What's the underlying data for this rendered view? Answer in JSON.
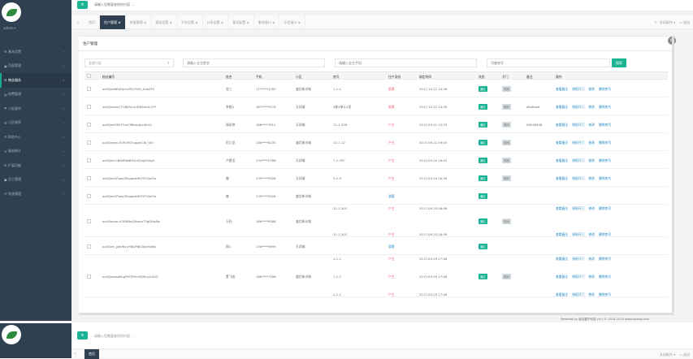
{
  "app": {
    "user": "admin+"
  },
  "topbar": {
    "search_placeholder": "请输入您需要查找的内容 ..."
  },
  "sidebar": {
    "items": [
      {
        "label": "基本设置",
        "active": false
      },
      {
        "label": "页面管理",
        "active": false
      },
      {
        "label": "物业服务",
        "active": true
      },
      {
        "label": "收费管理",
        "active": false
      },
      {
        "label": "小区超市",
        "active": false
      },
      {
        "label": "小区商家",
        "active": false
      },
      {
        "label": "财务中心",
        "active": false
      },
      {
        "label": "服务统计",
        "active": false
      },
      {
        "label": "扩展功能",
        "active": false
      },
      {
        "label": "员工管理",
        "active": false
      },
      {
        "label": "系统管理",
        "active": false
      }
    ]
  },
  "tabs": {
    "items": [
      "首页",
      "住户管理 ⊗",
      "房屋管理 ⊗",
      "基础设置 ⊗",
      "平台设置 ⊗",
      "分享设置 ⊗",
      "基本配置 ⊗",
      "聚合接口 ⊗",
      "乐信接口 ⊗"
    ],
    "close_ops": "关闭操作 ▾",
    "logout": "⇨ 退出"
  },
  "panel": {
    "title": "住户管理",
    "filters": {
      "community": "全部小区",
      "name_placeholder": "请输入业主姓名",
      "phone_placeholder": "请输入业主手机",
      "room_placeholder": "可查房号",
      "search_btn": "搜索"
    },
    "columns": [
      "粉丝编号",
      "姓名",
      "手机",
      "小区",
      "房号",
      "住户身份",
      "绑定时间",
      "状态",
      "开门",
      "备注",
      "操作"
    ],
    "rows": [
      {
        "id": "oo4Qee8RdGJmuRTLPhlH_XobZFll",
        "name": "张三",
        "phone": "177****4762",
        "community": "盛芯新水城",
        "rooms": [
          "1-1-1"
        ],
        "roles": [
          "家属"
        ],
        "times": [
          "2017-10-12 14:36"
        ],
        "status": "通过",
        "door": "关闭",
        "note": "",
        "ops": [
          "查看备注",
          "授权开门",
          "修改",
          "删除房号"
        ]
      },
      {
        "id": "oo4QeexloT7U8DVynUZN6vt0LOYY",
        "name": "李晓Ji",
        "phone": "187****3576",
        "community": "天润城",
        "rooms": [
          "4栋4单元4室"
        ],
        "roles": [
          "家属"
        ],
        "times": [
          "2017-10-12 14:35"
        ],
        "status": "通过",
        "door": "关闭",
        "note": "dfsdfasd",
        "ops": [
          "查看备注",
          "授权开门",
          "修改",
          "删除房号"
        ]
      },
      {
        "id": "oo4Qee33K7FzvCf6Kos4Jzl4fcXs",
        "name": "杨彩艳",
        "phone": "188****7611",
        "community": "天润城",
        "rooms": [
          "12-1-308"
        ],
        "roles": [
          "户主"
        ],
        "times": [
          "2017-09-21 10:33"
        ],
        "status": "通过",
        "door": "关闭",
        "note": "56548548",
        "ops": [
          "查看备注",
          "授权开门",
          "修改",
          "删除房号"
        ]
      },
      {
        "id": "oo4Qeeyv-XUH3Hi7uqqmC6l_t0U",
        "name": "田江龙",
        "phone": "186****8235",
        "community": "盛芯新水城",
        "rooms": [
          "12-1-12"
        ],
        "roles": [
          "户主"
        ],
        "times": [
          "2017-09-21 09:03"
        ],
        "status": "通过",
        "door": "关闭",
        "note": "",
        "ops": [
          "查看备注",
          "授权开门",
          "修改",
          "删除房号"
        ]
      },
      {
        "id": "oo4Qee-CBWfRdNFKli-6Qlqj43dyk",
        "name": "卢晨龙",
        "phone": "134****5786",
        "community": "天润城",
        "rooms": [
          "7-1-707"
        ],
        "roles": [
          "户主"
        ],
        "times": [
          "2017-09-20 18:43"
        ],
        "status": "通过",
        "door": "关闭",
        "note": "",
        "ops": [
          "查看备注",
          "授权开门",
          "修改",
          "删除房号"
        ]
      },
      {
        "id": "oo4Qee1PqayZKsqook9tOYCVJoOw",
        "name": "森",
        "phone": "139****5508",
        "community": "天润城",
        "rooms": [
          "5-1-9"
        ],
        "roles": [
          "户主"
        ],
        "times": [
          "2017-09-20 18:28"
        ],
        "status": "通过",
        "door": "关闭",
        "note": "",
        "ops": [
          "查看备注",
          "授权开门",
          "修改",
          "删除房号"
        ]
      },
      {
        "id": "oo4Qee1PqayZKsqook9tOYCVJoOw",
        "name": "森",
        "phone": "139****5508",
        "community": "盛芯新水城",
        "rooms": [
          ""
        ],
        "roles": [
          "游客"
        ],
        "times": [
          ""
        ],
        "status": "通过",
        "door": "",
        "note": "",
        "ops": []
      },
      {
        "id": "oo4Qeezb-aT60fNqQWwmT3gDHo8w",
        "name": "万科",
        "phone": "186****8588",
        "community": "盛芯新水城",
        "rooms": [
          "11-1-502",
          "11-1-502"
        ],
        "roles": [
          "户主",
          "户主"
        ],
        "times": [
          "2017-09-20 08:58",
          "2017-09-20 08:58"
        ],
        "status": "通过",
        "door": "关闭",
        "note": "",
        "ops": [
          "查看备注",
          "授权开门",
          "修改",
          "删除房号"
        ]
      },
      {
        "id": "oo4Qee_gwtWcyHNGP6EZbknWdjs",
        "name": "周1",
        "phone": "138****9999",
        "community": "天润城",
        "rooms": [
          ""
        ],
        "roles": [
          "游客"
        ],
        "times": [
          ""
        ],
        "status": "通过",
        "door": "",
        "note": "",
        "ops": []
      },
      {
        "id": "oo4Qeexsd8LgPeTjPHmDDEuyLGUQ",
        "name": "董飞宏",
        "phone": "186****7186",
        "community": "盛芯新水城",
        "rooms": [
          "1-1-1",
          "1-1-1",
          "1-1-1"
        ],
        "roles": [
          "户主",
          "户主",
          "户主"
        ],
        "times": [
          "2017-09-19 17:48",
          "2017-09-19 17:48",
          "2017-09-19 17:48"
        ],
        "status": "通过",
        "door": "关闭",
        "note": "",
        "ops": [
          "查看备注",
          "授权开门",
          "修改",
          "删除房号"
        ]
      }
    ]
  },
  "footer": "Powered by 南京晨午科技 v9.0 © 2014-2015 www.xjzhsq.com"
}
